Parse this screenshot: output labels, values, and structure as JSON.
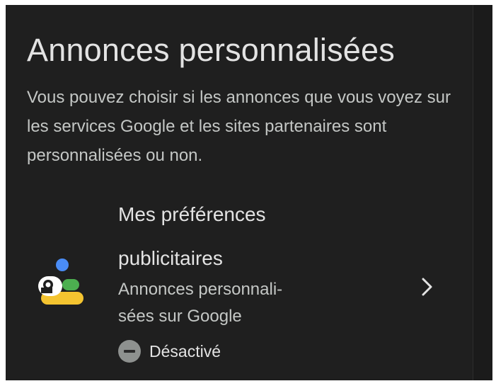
{
  "section": {
    "title": "Annonces personnalisées",
    "description": "Vous pouvez choisir si les annonces que vous voyez sur les services Google et les sites par­tenaires sont personnalisées ou non."
  },
  "card": {
    "title_line1": "Mes préférences",
    "title_line2": "publicitaires",
    "subtitle_line1": "Annonces personnali-",
    "subtitle_line2": "sées sur Google",
    "status_label": "Désactivé",
    "icon": "ad-preferences-illustration-icon",
    "chevron_icon": "chevron-right-icon",
    "status_icon": "minus-circle-icon"
  },
  "colors": {
    "background": "#1f1f1f",
    "text_primary": "#e3e3e3",
    "text_secondary": "#c4c7c5",
    "status_icon": "#8e918f"
  }
}
